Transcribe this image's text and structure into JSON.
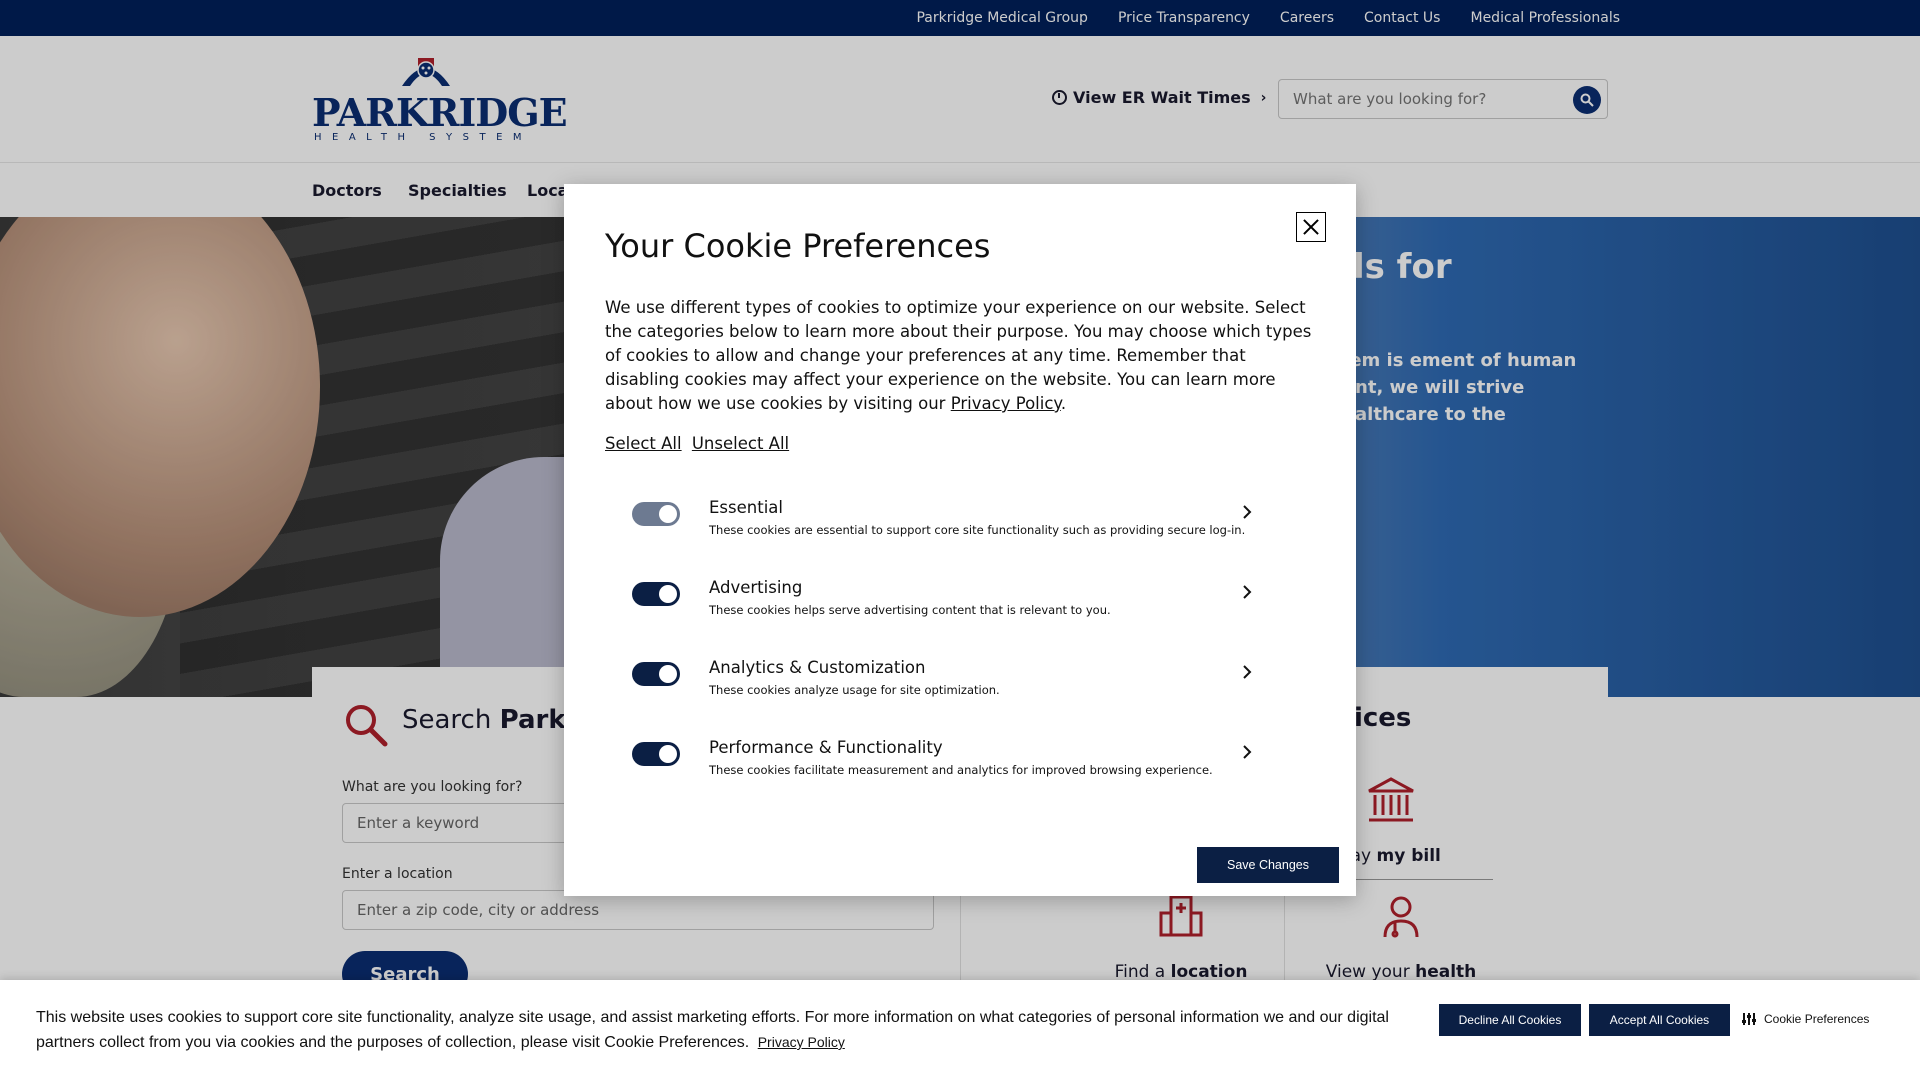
{
  "utility_nav": [
    "Parkridge Medical Group",
    "Price Transparency",
    "Careers",
    "Contact Us",
    "Medical Professionals"
  ],
  "logo": {
    "word": "PARKRIDGE",
    "sub": "HEALTH SYSTEM"
  },
  "header": {
    "er_link": "View ER Wait Times",
    "search_placeholder": "What are you looking for?"
  },
  "main_nav": [
    "Doctors",
    "Specialties",
    "Locations"
  ],
  "hero": {
    "title_fragment": "als for",
    "body_fragment": "stem is ement of human nent, we will strive healthcare to the"
  },
  "search_card": {
    "title_prefix": "Search ",
    "title_bold": "Parkridge",
    "keyword_label": "What are you looking for?",
    "keyword_placeholder": "Enter a keyword",
    "location_label": "Enter a location",
    "location_placeholder": "Enter a zip code, city or address",
    "button": "Search"
  },
  "services_card": {
    "title_fragment": "vices",
    "items": [
      {
        "pre": "Pay ",
        "bold": "my bill",
        "icon": "bank-icon"
      },
      {
        "pre": "Find a ",
        "bold": "location",
        "icon": "hospital-building-icon"
      },
      {
        "pre": "View your ",
        "bold": "health records",
        "icon": "doctor-icon"
      }
    ]
  },
  "modal": {
    "title": "Your Cookie Preferences",
    "description": "We use different types of cookies to optimize your experience on our website. Select the categories below to learn more about their purpose. You may choose which types of cookies to allow and change your preferences at any time. Remember that disabling cookies may affect your experience on the website. You can learn more about how we use cookies by visiting our",
    "privacy_link": "Privacy Policy",
    "select_all": "Select All",
    "unselect_all": "Unselect All",
    "categories": [
      {
        "name": "Essential",
        "desc": "These cookies are essential to support core site functionality such as providing secure log-in.",
        "enabled": true,
        "locked": true
      },
      {
        "name": "Advertising",
        "desc": "These cookies helps serve advertising content that is relevant to you.",
        "enabled": true,
        "locked": false
      },
      {
        "name": "Analytics & Customization",
        "desc": "These cookies analyze usage for site optimization.",
        "enabled": true,
        "locked": false
      },
      {
        "name": "Performance & Functionality",
        "desc": "These cookies facilitate measurement and analytics for improved browsing experience.",
        "enabled": true,
        "locked": false
      }
    ],
    "save_button": "Save Changes"
  },
  "banner": {
    "text": "This website uses cookies to support core site functionality, analyze site usage, and assist marketing efforts. For more information on what categories of personal information we and our digital partners collect from you via cookies and the purposes of collection, please visit Cookie Preferences.",
    "privacy_link": "Privacy Policy",
    "decline": "Decline All Cookies",
    "accept": "Accept All Cookies",
    "preferences": "Cookie Preferences"
  },
  "colors": {
    "navy": "#00205b",
    "dark_navy": "#0b1f44",
    "brand_red": "#b0202b"
  }
}
